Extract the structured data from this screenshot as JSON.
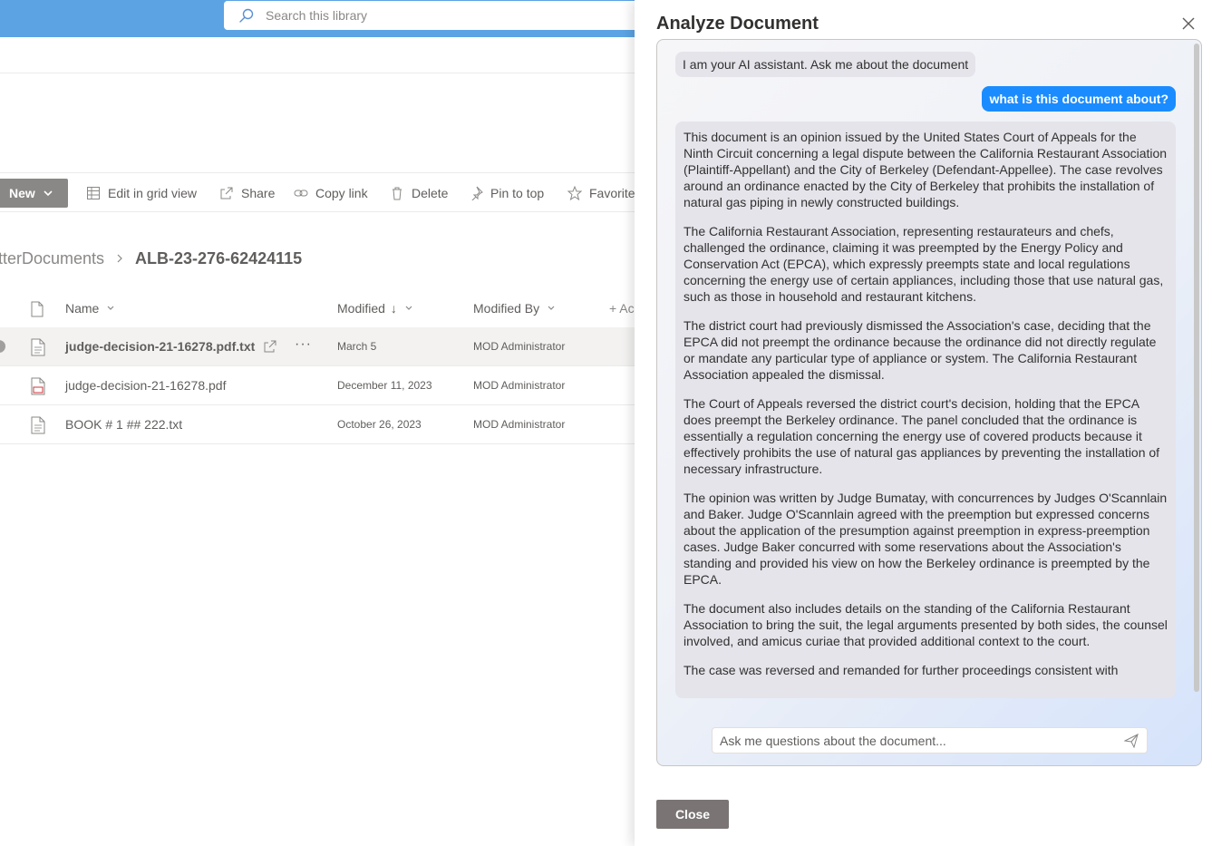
{
  "search": {
    "placeholder": "Search this library"
  },
  "toolbar": {
    "new_label": "New",
    "edit_grid_label": "Edit in grid view",
    "share_label": "Share",
    "copy_link_label": "Copy link",
    "delete_label": "Delete",
    "pin_label": "Pin to top",
    "favorite_label": "Favorite"
  },
  "breadcrumb": {
    "parent": "tterDocuments",
    "current": "ALB-23-276-62424115"
  },
  "list": {
    "columns": {
      "name": "Name",
      "modified": "Modified",
      "modified_sort": "↓",
      "modified_by": "Modified By",
      "add_column": "+ Ac"
    },
    "rows": [
      {
        "name": "judge-decision-21-16278.pdf.txt",
        "modified": "March 5",
        "modified_by": "MOD Administrator",
        "more": "···"
      },
      {
        "name": "judge-decision-21-16278.pdf",
        "modified": "December 11, 2023",
        "modified_by": "MOD Administrator"
      },
      {
        "name": "BOOK # 1 ## 222.txt",
        "modified": "October 26, 2023",
        "modified_by": "MOD Administrator"
      }
    ]
  },
  "panel": {
    "title": "Analyze Document",
    "greeting": "I am your AI assistant. Ask me about the document",
    "user_question": "what is this document about?",
    "answer_paragraphs": [
      "This document is an opinion issued by the United States Court of Appeals for the Ninth Circuit concerning a legal dispute between the California Restaurant Association (Plaintiff-Appellant) and the City of Berkeley (Defendant-Appellee). The case revolves around an ordinance enacted by the City of Berkeley that prohibits the installation of natural gas piping in newly constructed buildings.",
      "The California Restaurant Association, representing restaurateurs and chefs, challenged the ordinance, claiming it was preempted by the Energy Policy and Conservation Act (EPCA), which expressly preempts state and local regulations concerning the energy use of certain appliances, including those that use natural gas, such as those in household and restaurant kitchens.",
      "The district court had previously dismissed the Association's case, deciding that the EPCA did not preempt the ordinance because the ordinance did not directly regulate or mandate any particular type of appliance or system. The California Restaurant Association appealed the dismissal.",
      "The Court of Appeals reversed the district court's decision, holding that the EPCA does preempt the Berkeley ordinance. The panel concluded that the ordinance is essentially a regulation concerning the energy use of covered products because it effectively prohibits the use of natural gas appliances by preventing the installation of necessary infrastructure.",
      "The opinion was written by Judge Bumatay, with concurrences by Judges O'Scannlain and Baker. Judge O'Scannlain agreed with the preemption but expressed concerns about the application of the presumption against preemption in express-preemption cases. Judge Baker concurred with some reservations about the Association's standing and provided his view on how the Berkeley ordinance is preempted by the EPCA.",
      "The document also includes details on the standing of the California Restaurant Association to bring the suit, the legal arguments presented by both sides, the counsel involved, and amicus curiae that provided additional context to the court.",
      "The case was reversed and remanded for further proceedings consistent with"
    ],
    "ask_placeholder": "Ask me questions about the document...",
    "close_label": "Close"
  },
  "colors": {
    "topbar": "#5ba3e3",
    "user_bubble": "#1a8cff",
    "ai_bubble": "#e4e4ea",
    "close_button": "#7a7574"
  }
}
